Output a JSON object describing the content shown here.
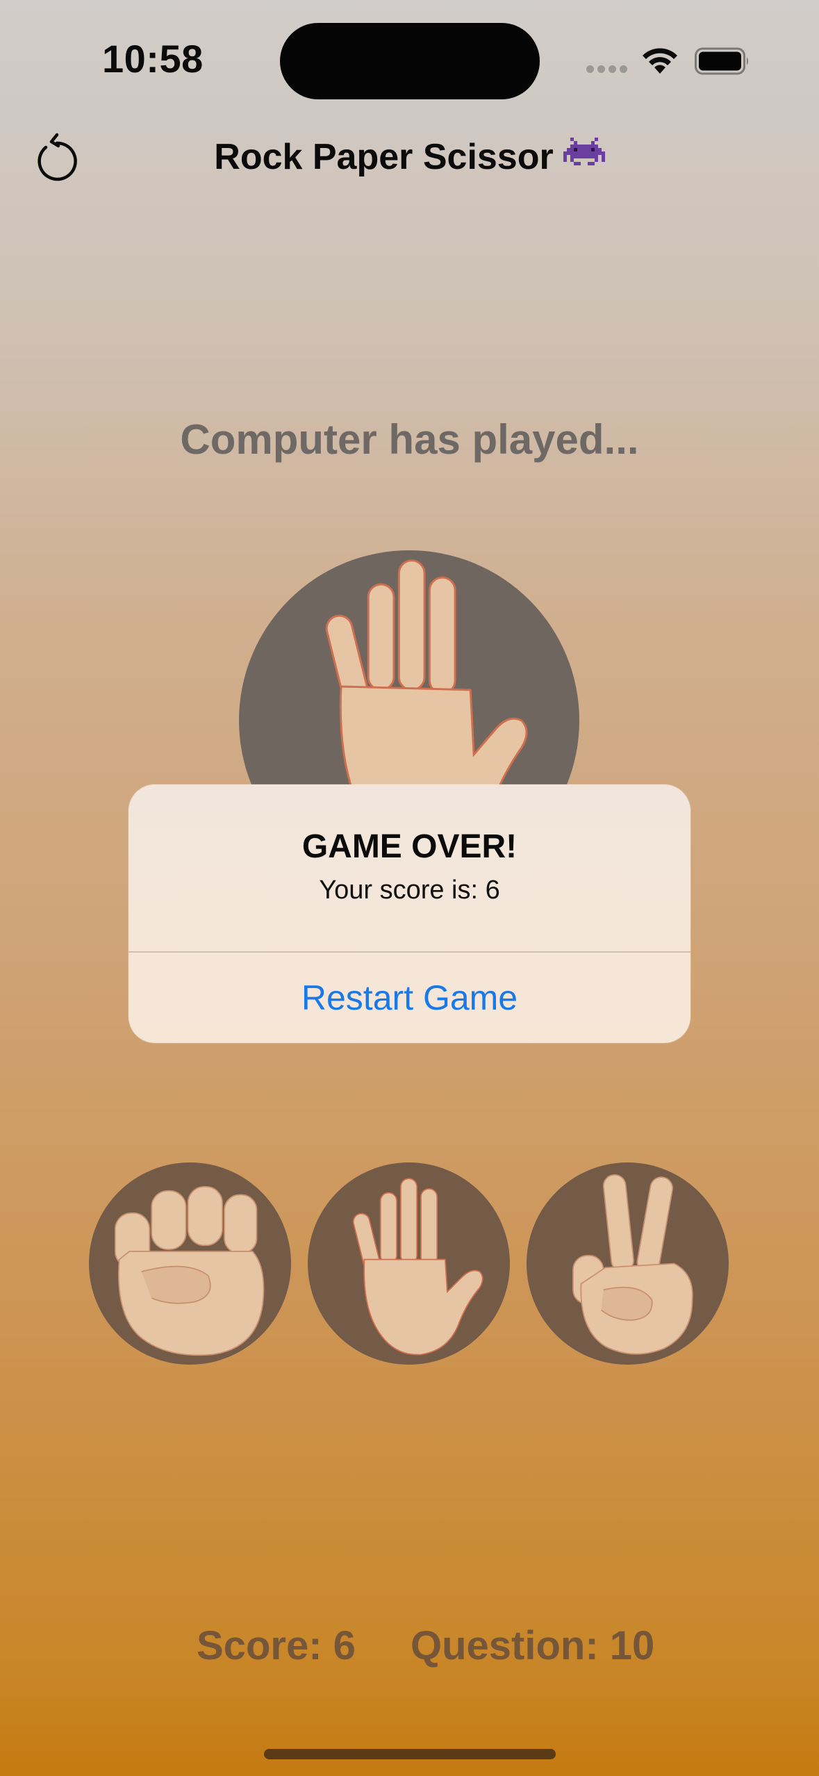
{
  "status_bar": {
    "time": "10:58",
    "icons": [
      "signal-icon",
      "wifi-icon",
      "battery-icon"
    ]
  },
  "nav": {
    "title": "Rock Paper Scissor",
    "title_emoji": "alien-monster-icon",
    "left_icon": "restart-icon"
  },
  "game": {
    "computer_label": "Computer has played...",
    "computer_choice": "paper",
    "choices": [
      "rock",
      "paper",
      "scissors"
    ]
  },
  "alert": {
    "title": "GAME OVER!",
    "message": "Your score is: 6",
    "button_label": "Restart Game"
  },
  "footer": {
    "score": "Score: 6",
    "question": "Question: 10"
  },
  "colors": {
    "accent": "#1979e8",
    "footer_text": "#765638",
    "choice_circle": "#735b48"
  }
}
